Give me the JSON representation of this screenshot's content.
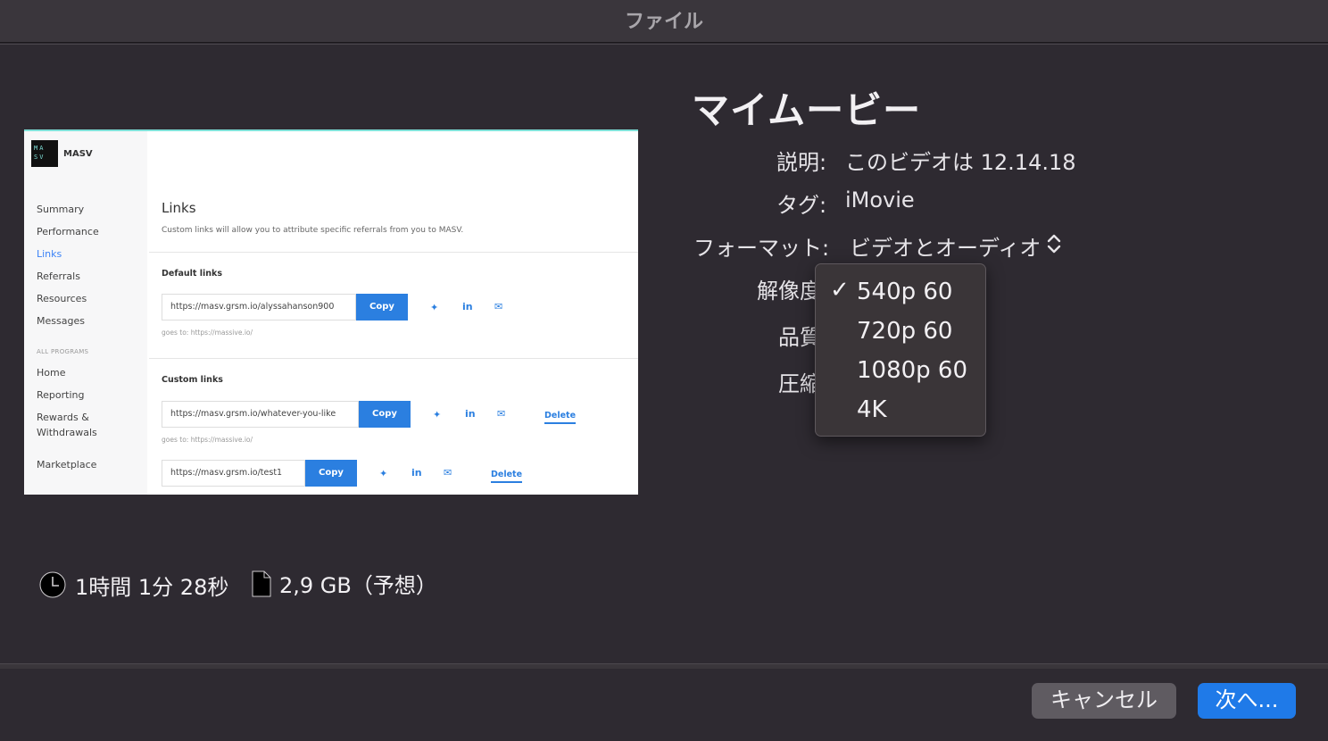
{
  "window": {
    "title": "ファイル"
  },
  "preview": {
    "brand": "MASV",
    "logo_text": "MA SV",
    "nav": [
      "Summary",
      "Performance",
      "Links",
      "Referrals",
      "Resources",
      "Messages"
    ],
    "nav_section_label": "ALL PROGRAMS",
    "nav2": [
      "Home",
      "Reporting",
      "Rewards &",
      "Withdrawals",
      "Marketplace"
    ],
    "heading": "Links",
    "subtitle": "Custom links will allow you to attribute specific referrals from you to MASV.",
    "default_links_label": "Default links",
    "custom_links_label": "Custom links",
    "links": [
      {
        "url": "https://masv.grsm.io/alyssahanson900",
        "copy": "Copy",
        "goes_to": "goes to: https://massive.io/"
      },
      {
        "url": "https://masv.grsm.io/whatever-you-like",
        "copy": "Copy",
        "goes_to": "goes to: https://massive.io/",
        "delete": "Delete"
      },
      {
        "url": "https://masv.grsm.io/test1",
        "copy": "Copy",
        "delete": "Delete"
      }
    ],
    "icons": [
      "twitter-icon",
      "linkedin-icon",
      "mail-icon"
    ]
  },
  "movie": {
    "title": "マイムービー",
    "description_label": "説明:",
    "description_value": "このビデオは 12.14.18",
    "tags_label": "タグ:",
    "tags_value": "iMovie",
    "format_label": "フォーマット:",
    "format_value": "ビデオとオーディオ",
    "resolution_label": "解像度",
    "quality_label": "品質",
    "compress_label": "圧縮"
  },
  "resolution_menu": {
    "options": [
      "540p 60",
      "720p 60",
      "1080p 60",
      "4K"
    ],
    "selected": "540p 60",
    "check": "✓"
  },
  "stats": {
    "duration": "1時間 1分 28秒",
    "size": "2,9 GB（予想）"
  },
  "buttons": {
    "cancel": "キャンセル",
    "next": "次へ..."
  },
  "colors": {
    "accent": "#1f7ae8",
    "background": "#2e2a31",
    "menu": "#3a3538"
  }
}
